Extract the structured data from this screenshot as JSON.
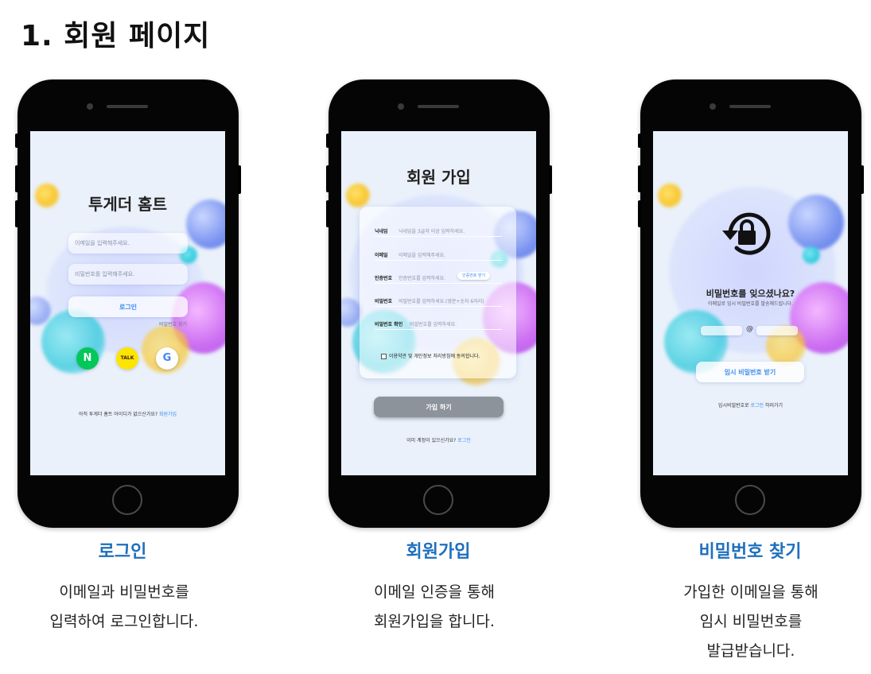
{
  "page": {
    "title": "1.  회원 페이지"
  },
  "login": {
    "app_title": "투게더 홈트",
    "email_placeholder": "이메일을 입력해주세요.",
    "password_placeholder": "비밀번호를 입력해주세요.",
    "login_button": "로그인",
    "forgot_link": "비밀번호 찾기",
    "social_naver": "N",
    "social_kakao": "TALK",
    "social_google": "G",
    "no_account_text": "아직 투게더 홈트 아이디가 없으신가요?",
    "signup_link": "회원가입"
  },
  "signup": {
    "title": "회원 가입",
    "fields": [
      {
        "label": "닉네임",
        "placeholder": "닉네임을 3글자 이상 입력하세요."
      },
      {
        "label": "이메일",
        "placeholder": "이메일을 입력해주세요."
      },
      {
        "label": "인증번호",
        "placeholder": "인증번호를 입력하세요."
      },
      {
        "label": "비밀번호",
        "placeholder": "비밀번호를 입력하세요.(영문+숫자 6자리)"
      },
      {
        "label": "비밀번호 확인",
        "placeholder": "비밀번호를 입력하세요."
      }
    ],
    "verify_button": "인증번호 받기",
    "agree_text": "이용약관 및 개인정보 처리방침에 동의합니다.",
    "join_button": "가입 하기",
    "have_account_text": "이미 계정이 있으신가요?",
    "login_link": "로그인"
  },
  "find_password": {
    "title": "비밀번호를 잊으셨나요?",
    "subtitle": "이메일로 임시 비밀번호를 발송해드립니다.",
    "at_sign": "@",
    "temp_button": "임시 비밀번호 받기",
    "bottom_prefix": "임시비밀번호로",
    "bottom_link": "로그인",
    "bottom_suffix": "하러가기"
  },
  "captions": [
    {
      "title": "로그인",
      "lines": [
        "이메일과 비밀번호를",
        "입력하여 로그인합니다."
      ]
    },
    {
      "title": "회원가입",
      "lines": [
        "이메일 인증을 통해",
        "회원가입을 합니다."
      ]
    },
    {
      "title": "비밀번호 찾기",
      "lines": [
        "가입한 이메일을 통해",
        "임시 비밀번호를",
        "발급받습니다."
      ]
    }
  ],
  "colors": {
    "accent": "#3d8df0",
    "caption_title": "#1f6fbd",
    "naver": "#03c75a",
    "kakao": "#fee500",
    "join_button": "#8d939b"
  },
  "icons": {
    "lock": "lock-reset-icon",
    "naver": "naver-icon",
    "kakao": "kakao-icon",
    "google": "google-icon"
  }
}
